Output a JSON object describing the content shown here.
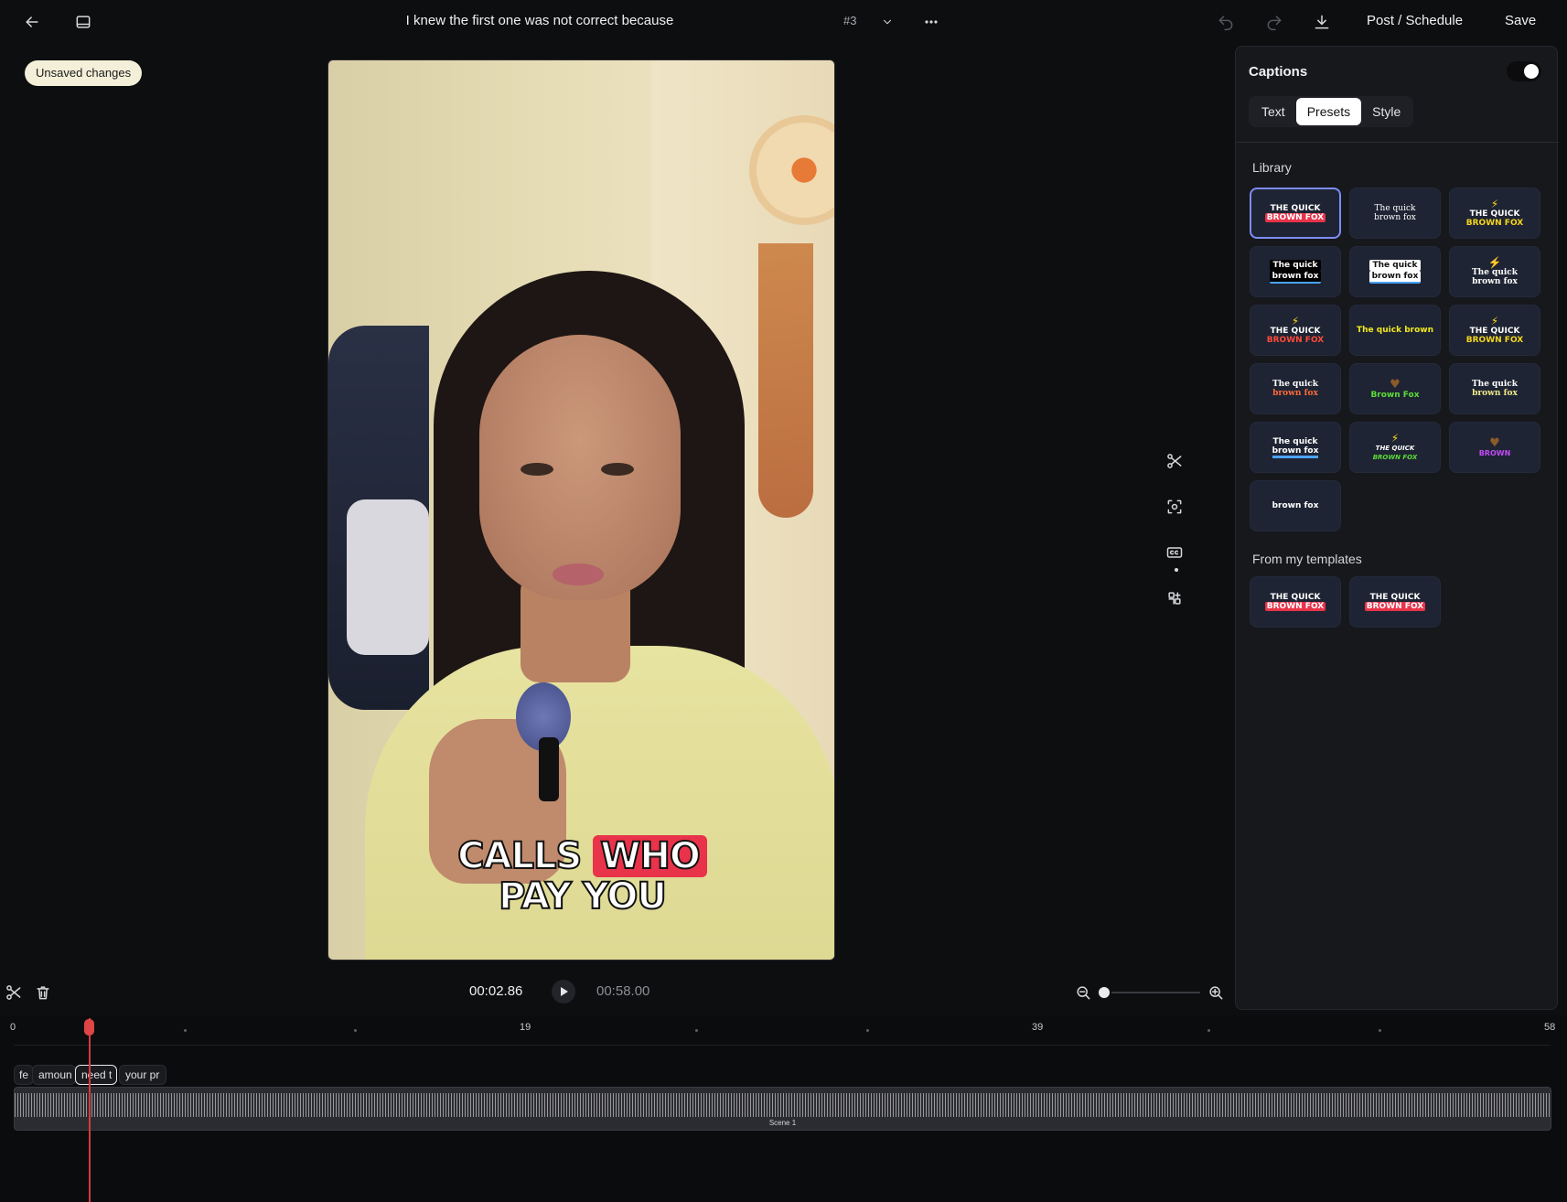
{
  "header": {
    "title": "I knew the first one was not correct because",
    "version": "#3",
    "post_label": "Post / Schedule",
    "save_label": "Save"
  },
  "status": {
    "unsaved": "Unsaved changes"
  },
  "video": {
    "caption_line1_a": "CALLS",
    "caption_line1_b": "WHO",
    "caption_line2": "PAY YOU",
    "highlight_color": "#e8334a"
  },
  "captions_panel": {
    "title": "Captions",
    "enabled": true,
    "tabs": [
      {
        "label": "Text"
      },
      {
        "label": "Presets"
      },
      {
        "label": "Style"
      }
    ],
    "active_tab": "Presets",
    "library_label": "Library",
    "templates_label": "From my templates",
    "library": [
      {
        "l1": "THE QUICK",
        "l2": "BROWN FOX"
      },
      {
        "l1": "The quick",
        "l2": "brown fox"
      },
      {
        "l1": "THE QUICK",
        "l2": "BROWN FOX"
      },
      {
        "l1": "The quick",
        "l2": "brown fox"
      },
      {
        "l1": "The quick",
        "l2": "brown fox"
      },
      {
        "l1": "The quick",
        "l2": "brown fox"
      },
      {
        "l1": "THE QUICK",
        "l2": "BROWN FOX"
      },
      {
        "l1": "The quick brown",
        "l2": ""
      },
      {
        "l1": "THE QUICK",
        "l2": "BROWN FOX"
      },
      {
        "l1": "The quick",
        "l2": "brown fox"
      },
      {
        "l1": "Brown Fox",
        "l2": ""
      },
      {
        "l1": "The quick",
        "l2": "brown fox"
      },
      {
        "l1": "The quick",
        "l2": "brown fox"
      },
      {
        "l1": "THE QUICK",
        "l2": "BROWN FOX"
      },
      {
        "l1": "BROWN",
        "l2": ""
      },
      {
        "l1": "brown fox",
        "l2": ""
      }
    ],
    "templates": [
      {
        "l1": "THE QUICK",
        "l2": "BROWN FOX"
      },
      {
        "l1": "THE QUICK",
        "l2": "BROWN FOX"
      }
    ]
  },
  "player": {
    "current_time": "00:02.86",
    "duration": "00:58.00"
  },
  "timeline": {
    "ticks": [
      "0",
      "19",
      "39",
      "58"
    ],
    "words": [
      "fe",
      "amoun",
      "need t",
      "your pr"
    ],
    "scene_label": "Scene 1"
  },
  "icons": [
    "back-arrow-icon",
    "layout-icon",
    "chevron-down-icon",
    "more-icon",
    "undo-icon",
    "redo-icon",
    "download-icon",
    "scissors-icon",
    "focus-icon",
    "cc-icon",
    "layers-icon",
    "trash-icon",
    "zoom-out-icon",
    "zoom-in-icon",
    "play-icon"
  ]
}
